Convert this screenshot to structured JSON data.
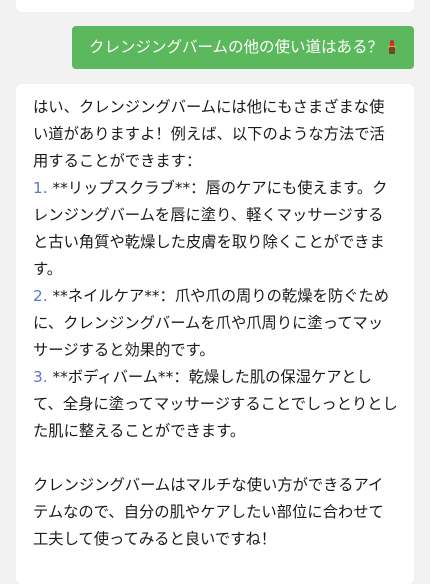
{
  "user_message": {
    "text": "クレンジングバームの他の使い道はある？",
    "emoji": "💄"
  },
  "bot_message": {
    "intro": "はい、クレンジングバームには他にもさまざまな使い道がありますよ！例えば、以下のような方法で活用することができます：",
    "items": [
      {
        "number": "1.",
        "text": " **リップスクラブ**：唇のケアにも使えます。クレンジングバームを唇に塗り、軽くマッサージすると古い角質や乾燥した皮膚を取り除くことができます。"
      },
      {
        "number": "2.",
        "text": " **ネイルケア**：爪や爪の周りの乾燥を防ぐために、クレンジングバームを爪や爪周りに塗ってマッサージすると効果的です。"
      },
      {
        "number": "3.",
        "text": " **ボディバーム**：乾燥した肌の保湿ケアとして、全身に塗ってマッサージすることでしっとりとした肌に整えることができます。"
      }
    ],
    "closing": "クレンジングバームはマルチな使い方ができるアイテムなので、自分の肌やケアしたい部位に合わせて工夫して使ってみると良いですね！"
  },
  "colors": {
    "user_bubble": "#5cb85c",
    "background": "#f2f2f2",
    "bot_bubble": "#ffffff"
  }
}
